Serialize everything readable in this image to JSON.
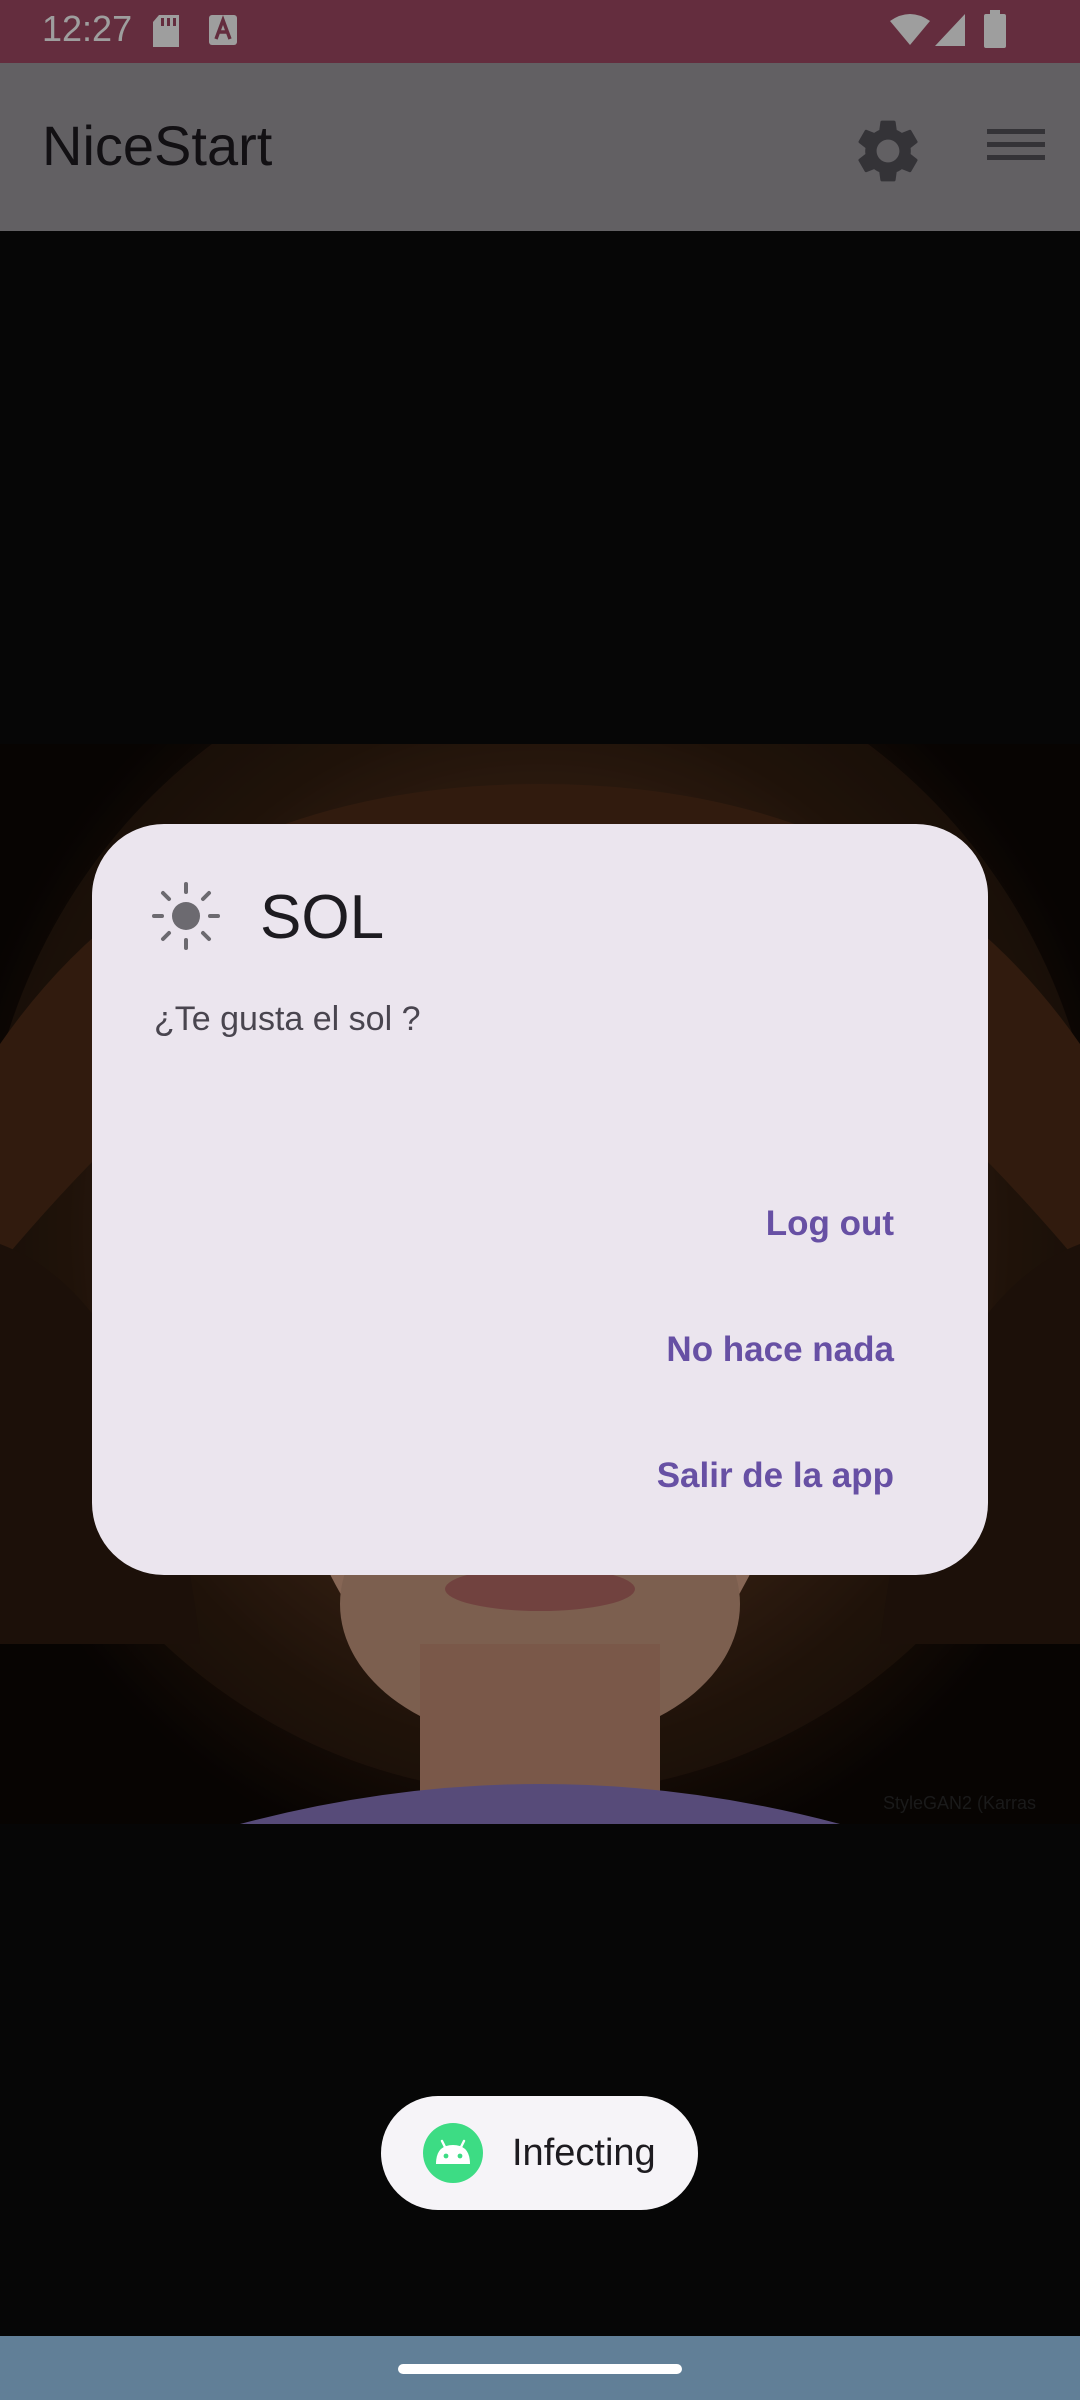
{
  "status_bar": {
    "time": "12:27",
    "icons": [
      "sd-card-icon",
      "font-a-icon",
      "wifi-icon",
      "cell-signal-icon",
      "battery-icon"
    ]
  },
  "app_bar": {
    "title": "NiceStart",
    "icons": [
      "gear-icon",
      "menu-icon"
    ]
  },
  "photo": {
    "credit": "StyleGAN2 (Karras"
  },
  "dialog": {
    "icon": "sun-icon",
    "title": "SOL",
    "message": "¿Te gusta el sol ?",
    "buttons": {
      "logout": "Log out",
      "nothing": "No hace nada",
      "exit": "Salir de la app"
    }
  },
  "toast": {
    "icon": "android-icon",
    "text": "Infecting"
  },
  "colors": {
    "status_bar": "#a24a64",
    "app_bar": "#9e9ba1",
    "dialog_bg": "#ebe5ee",
    "accent": "#6750a4",
    "nav_bar": "#617f97"
  }
}
